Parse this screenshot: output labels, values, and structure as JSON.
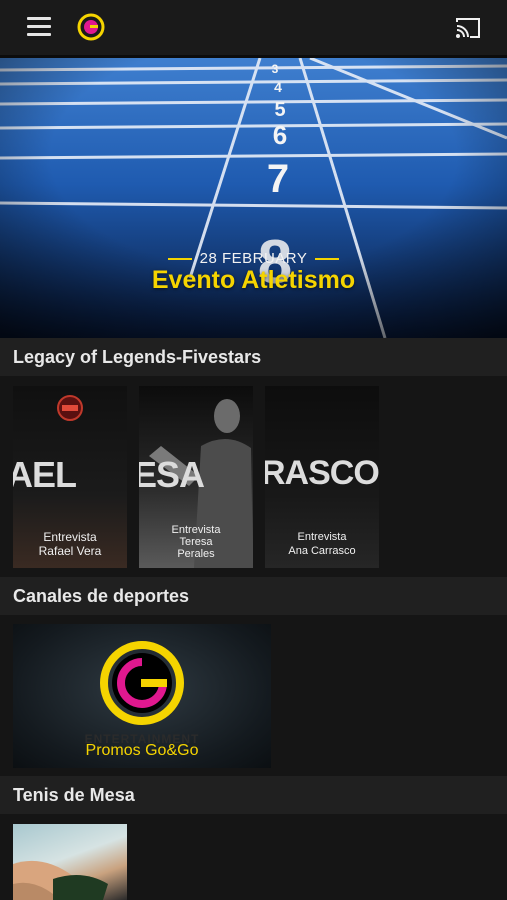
{
  "topbar": {
    "menu_icon": "hamburger-menu-icon",
    "logo_icon": "gogo-logo-icon",
    "cast_icon": "cast-icon",
    "accent_colors": [
      "#f5d400",
      "#e0188f"
    ]
  },
  "hero": {
    "date": "28 FEBRUARY",
    "title": "Evento Atletismo",
    "lane_numbers": [
      "3",
      "4",
      "5",
      "6",
      "7",
      "8"
    ]
  },
  "sections": [
    {
      "title": "Legacy of Legends-Fivestars",
      "cards": [
        {
          "overlay_text": "AEL",
          "caption": [
            "Entrevista",
            "Rafael Vera"
          ]
        },
        {
          "overlay_text": "ESA",
          "caption": [
            "Entrevista",
            "Teresa",
            "Perales"
          ]
        },
        {
          "overlay_text": "RASCO",
          "caption": [
            "Entrevista",
            "Ana Carrasco"
          ]
        }
      ]
    },
    {
      "title": "Canales de deportes",
      "cards": [
        {
          "overlay_text": "ENTERTAINMENT",
          "caption": [
            "Promos Go&Go"
          ]
        }
      ]
    },
    {
      "title": "Tenis de Mesa",
      "cards": []
    }
  ]
}
